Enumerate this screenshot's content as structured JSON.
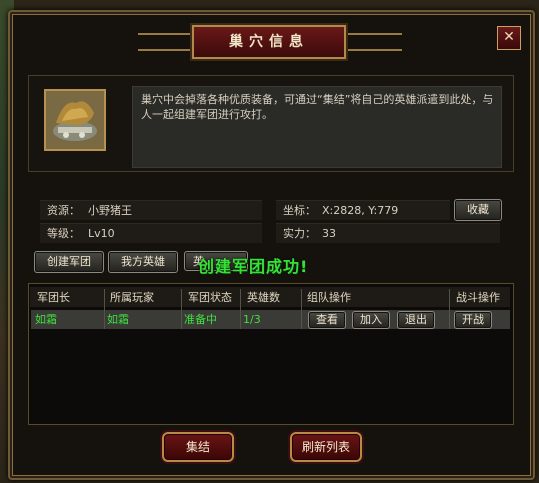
{
  "window": {
    "title": "巢穴信息",
    "close_symbol": "✕"
  },
  "lair": {
    "icon": "lair-portrait-icon",
    "description": "巢穴中会掉落各种优质装备，可通过“集结”将自己的英雄派遣到此处，与人一起组建军团进行攻打。"
  },
  "info": {
    "resource_label": "资源：",
    "resource_value": "小野猪王",
    "coord_label": "坐标：",
    "coord_value": "X:2828, Y:779",
    "level_label": "等级：",
    "level_value": "Lv10",
    "power_label": "实力：",
    "power_value": "33",
    "favorite_button": "收藏"
  },
  "actions": {
    "create_legion": "创建军团",
    "my_heroes": "我方英雄",
    "third_button": "英"
  },
  "success_message": "创建军团成功!",
  "table": {
    "headers": [
      "军团长",
      "所属玩家",
      "军团状态",
      "英雄数",
      "组队操作",
      "战斗操作"
    ],
    "rows": [
      {
        "leader": "如霜",
        "player": "如霜",
        "status": "准备中",
        "heroes": "1/3",
        "team_ops": [
          "查看",
          "加入",
          "退出"
        ],
        "battle_op": "开战"
      }
    ]
  },
  "footer": {
    "gather_button": "集结",
    "refresh_button": "刷新列表"
  },
  "colors": {
    "success_text": "#38e038",
    "row_text": "#40e040",
    "title_plate": "#6a1818",
    "frame_border": "#6e5a34"
  }
}
